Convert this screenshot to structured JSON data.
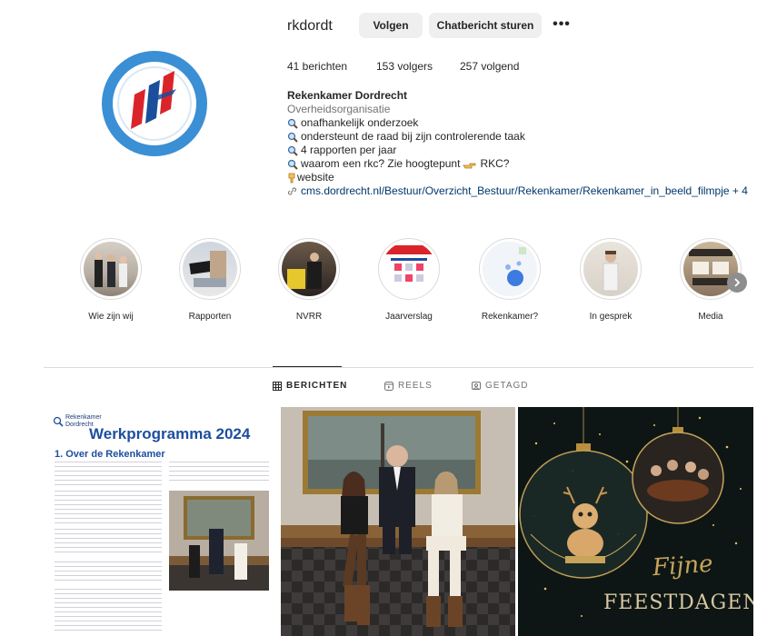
{
  "profile": {
    "username": "rkdordt",
    "follow_label": "Volgen",
    "message_label": "Chatbericht sturen",
    "more_icon": "more-horizontal-icon",
    "stats": {
      "posts": "41 berichten",
      "followers": "153 volgers",
      "following": "257 volgend"
    },
    "bio": {
      "name": "Rekenkamer Dordrecht",
      "category": "Overheidsorganisatie",
      "lines": [
        "onafhankelijk onderzoek",
        "ondersteunt de raad bij zijn controlerende taak",
        "4 rapporten per jaar",
        "waarom een rkc? Zie hoogtepunt"
      ],
      "line4_suffix": "RKC?",
      "website_label": "website",
      "link": "cms.dordrecht.nl/Bestuur/Overzicht_Bestuur/Rekenkamer/Rekenkamer_in_beeld_filmpje + 4"
    },
    "logo_colors": {
      "ring": "#3b8fd4",
      "red": "#d9252a",
      "blue": "#1b4f9c"
    }
  },
  "highlights": [
    {
      "label": "Wie zijn wij"
    },
    {
      "label": "Rapporten"
    },
    {
      "label": "NVRR"
    },
    {
      "label": "Jaarverslag"
    },
    {
      "label": "Rekenkamer?"
    },
    {
      "label": "In gesprek"
    },
    {
      "label": "Media"
    }
  ],
  "tabs": [
    {
      "label": "BERICHTEN",
      "icon": "grid-icon",
      "active": true
    },
    {
      "label": "REELS",
      "icon": "reels-icon",
      "active": false
    },
    {
      "label": "GETAGD",
      "icon": "tagged-icon",
      "active": false
    }
  ],
  "posts": {
    "p1": {
      "logo_line1": "Rekenkamer",
      "logo_line2": "Dordrecht",
      "title": "Werkprogramma 2024",
      "heading": "1. Over de Rekenkamer"
    },
    "p3": {
      "script_text": "Fijne",
      "caps_text": "FEESTDAGEN"
    }
  }
}
